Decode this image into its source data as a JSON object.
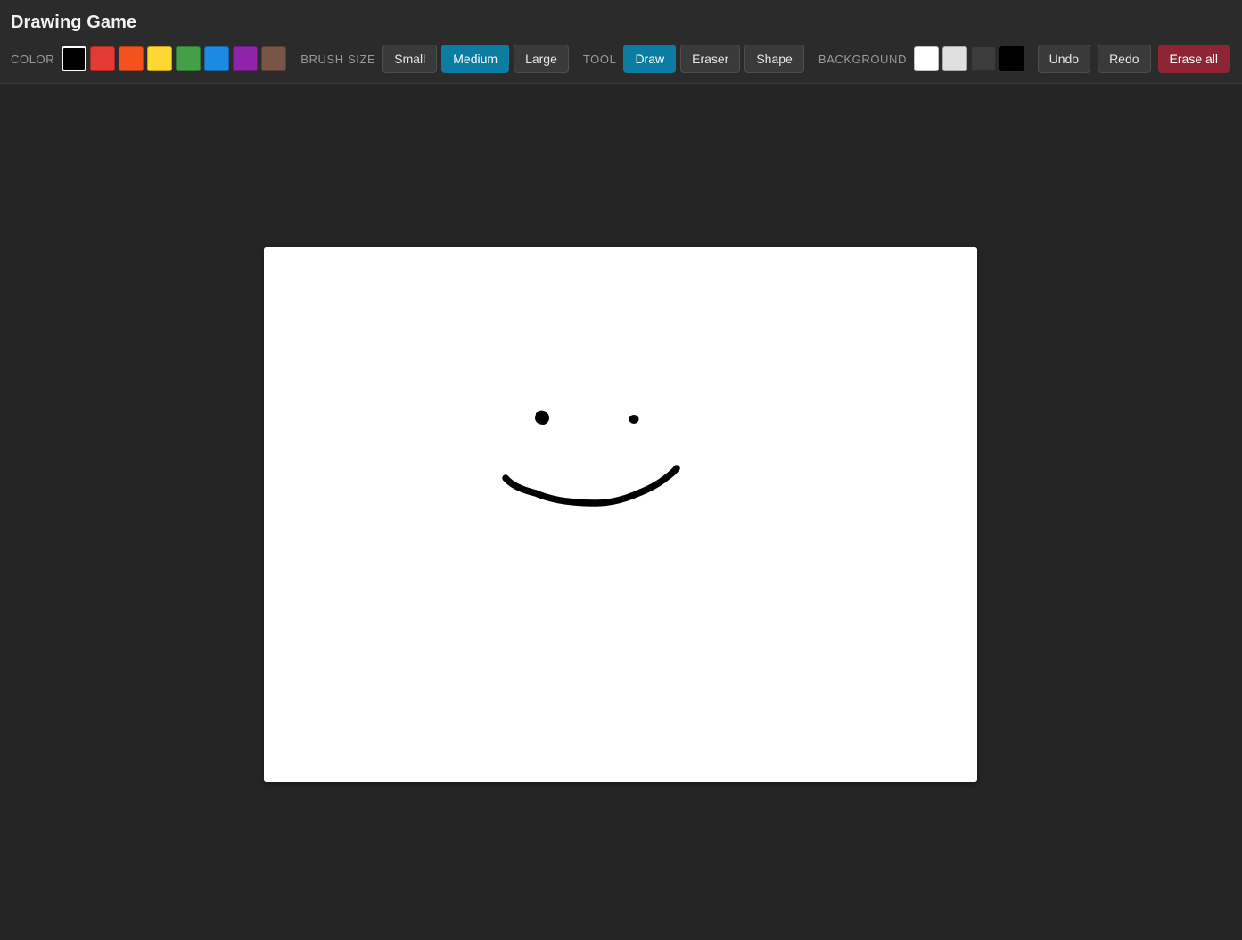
{
  "app": {
    "title": "Drawing Game"
  },
  "toolbar": {
    "color": {
      "label": "COLOR",
      "selected_index": 0,
      "swatches": [
        {
          "name": "black",
          "hex": "#000000"
        },
        {
          "name": "red",
          "hex": "#e53935"
        },
        {
          "name": "orange",
          "hex": "#f4511e"
        },
        {
          "name": "yellow",
          "hex": "#fdd835"
        },
        {
          "name": "green",
          "hex": "#43a047"
        },
        {
          "name": "blue",
          "hex": "#1e88e5"
        },
        {
          "name": "purple",
          "hex": "#8e24aa"
        },
        {
          "name": "brown",
          "hex": "#795548"
        }
      ]
    },
    "brush_size": {
      "label": "BRUSH SIZE",
      "options": [
        "Small",
        "Medium",
        "Large"
      ],
      "selected": "Medium"
    },
    "tool": {
      "label": "TOOL",
      "options": [
        "Draw",
        "Eraser",
        "Shape"
      ],
      "selected": "Draw"
    },
    "background": {
      "label": "BACKGROUND",
      "selected_index": 0,
      "swatches": [
        {
          "name": "white",
          "hex": "#ffffff"
        },
        {
          "name": "light-gray",
          "hex": "#e0e0e0"
        },
        {
          "name": "dark-gray",
          "hex": "#3c3c3c"
        },
        {
          "name": "black",
          "hex": "#000000"
        }
      ]
    },
    "actions": {
      "undo_label": "Undo",
      "redo_label": "Redo",
      "erase_all_label": "Erase all"
    }
  },
  "canvas": {
    "background_color": "#ffffff",
    "stroke_color": "#000000",
    "drawing": "smiley-face"
  }
}
